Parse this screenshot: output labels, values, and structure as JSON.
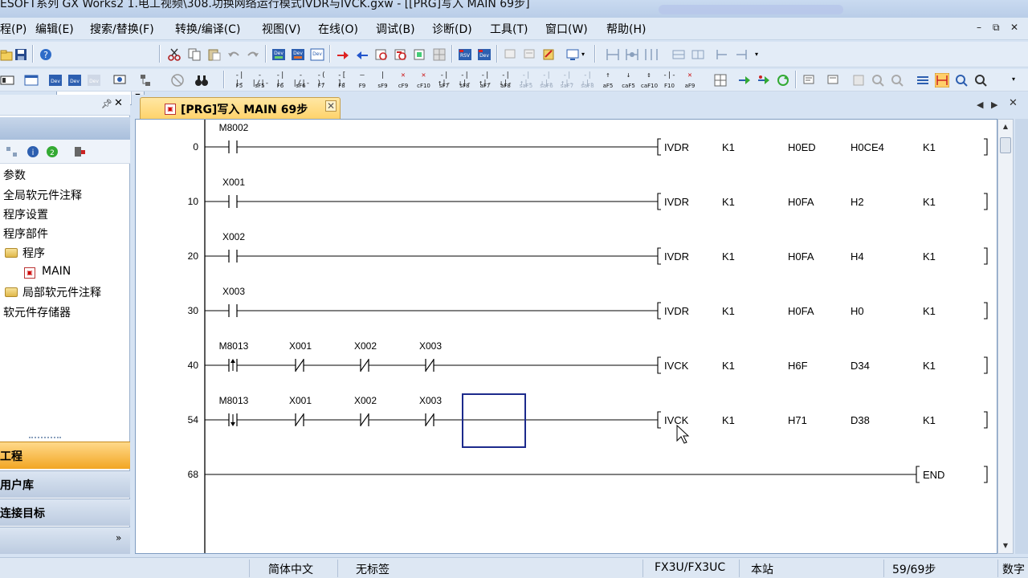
{
  "window": {
    "title": "ESOFT系列 GX Works2 1.电工视频\\308.功换网络运行模式IVDR与IVCK.gxw - [[PRG]写入 MAIN 69步]"
  },
  "menu": {
    "items": [
      "程(P)",
      "编辑(E)",
      "搜索/替换(F)",
      "转换/编译(C)",
      "视图(V)",
      "在线(O)",
      "调试(B)",
      "诊断(D)",
      "工具(T)",
      "窗口(W)",
      "帮助(H)"
    ],
    "controls": [
      "–",
      "⧉",
      "✕"
    ]
  },
  "toolbar": {
    "combo_value": "",
    "fkeys": [
      {
        "glyph": "-| |-",
        "label": "F5"
      },
      {
        "glyph": "-|/|-",
        "label": "sF5"
      },
      {
        "glyph": "-| |-",
        "label": "F6"
      },
      {
        "glyph": "-|/|-",
        "label": "sF6"
      },
      {
        "glyph": "-( )-",
        "label": "F7"
      },
      {
        "glyph": "-[ ]-",
        "label": "F8"
      },
      {
        "glyph": "—",
        "label": "F9"
      },
      {
        "glyph": "|",
        "label": "sF9"
      },
      {
        "glyph": "✕",
        "label": "cF9"
      },
      {
        "glyph": "✕",
        "label": "cF10"
      },
      {
        "glyph": "-|↑|-",
        "label": "sF7"
      },
      {
        "glyph": "-|↓|-",
        "label": "sF8"
      },
      {
        "glyph": "-|↑|-",
        "label": "aF7"
      },
      {
        "glyph": "-|↓|-",
        "label": "aF8"
      },
      {
        "glyph": "-|↑|-",
        "label": "saF5"
      },
      {
        "glyph": "-|↓|-",
        "label": "saF6"
      },
      {
        "glyph": "-|↑|-",
        "label": "saF7"
      },
      {
        "glyph": "-|↓|-",
        "label": "saF8"
      },
      {
        "glyph": "↑",
        "label": "aF5"
      },
      {
        "glyph": "↓",
        "label": "caF5"
      },
      {
        "glyph": "↕",
        "label": "caF10"
      },
      {
        "glyph": "-|-",
        "label": "F10"
      },
      {
        "glyph": "✕",
        "label": "aF9"
      }
    ]
  },
  "left_panel": {
    "tree": [
      "参数",
      "全局软元件注释",
      "程序设置",
      "程序部件",
      "程序",
      "MAIN",
      "局部软元件注释",
      "软元件存储器"
    ],
    "tabs": [
      "工程",
      "用户库",
      "连接目标"
    ],
    "more": "»"
  },
  "editor_tab": {
    "label": "[PRG]写入 MAIN 69步",
    "close": "✕"
  },
  "ladder": {
    "rungs": [
      {
        "step": "0",
        "contacts": [
          {
            "device": "M8002",
            "kind": "NO"
          }
        ],
        "instruction": [
          "IVDR",
          "K1",
          "H0ED",
          "H0CE4",
          "K1"
        ]
      },
      {
        "step": "10",
        "contacts": [
          {
            "device": "X001",
            "kind": "NO"
          }
        ],
        "instruction": [
          "IVDR",
          "K1",
          "H0FA",
          "H2",
          "K1"
        ]
      },
      {
        "step": "20",
        "contacts": [
          {
            "device": "X002",
            "kind": "NO"
          }
        ],
        "instruction": [
          "IVDR",
          "K1",
          "H0FA",
          "H4",
          "K1"
        ]
      },
      {
        "step": "30",
        "contacts": [
          {
            "device": "X003",
            "kind": "NO"
          }
        ],
        "instruction": [
          "IVDR",
          "K1",
          "H0FA",
          "H0",
          "K1"
        ]
      },
      {
        "step": "40",
        "contacts": [
          {
            "device": "M8013",
            "kind": "RISE"
          },
          {
            "device": "X001",
            "kind": "NC"
          },
          {
            "device": "X002",
            "kind": "NC"
          },
          {
            "device": "X003",
            "kind": "NC"
          }
        ],
        "instruction": [
          "IVCK",
          "K1",
          "H6F",
          "D34",
          "K1"
        ]
      },
      {
        "step": "54",
        "contacts": [
          {
            "device": "M8013",
            "kind": "FALL"
          },
          {
            "device": "X001",
            "kind": "NC"
          },
          {
            "device": "X002",
            "kind": "NC"
          },
          {
            "device": "X003",
            "kind": "NC"
          }
        ],
        "instruction": [
          "IVCK",
          "K1",
          "H71",
          "D38",
          "K1"
        ]
      },
      {
        "step": "68",
        "contacts": [],
        "instruction": [
          "END"
        ]
      }
    ]
  },
  "statusbar": {
    "language": "简体中文",
    "label": "无标签",
    "cpu": "FX3U/FX3UC",
    "station": "本站",
    "steps": "59/69步",
    "mode": "数字"
  }
}
